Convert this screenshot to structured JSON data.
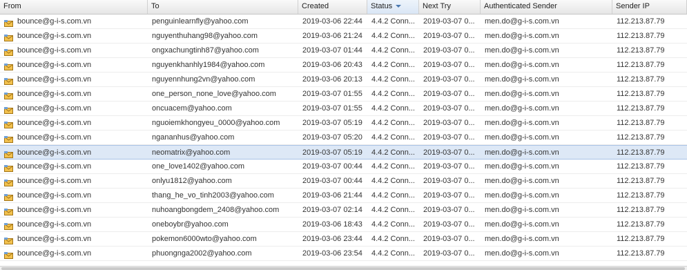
{
  "columns": [
    "From",
    "To",
    "Created",
    "Status",
    "Next Try",
    "Authenticated Sender",
    "Sender IP"
  ],
  "sorted_column": "Status",
  "row_icon": "mail-queue-icon",
  "selected_index": 9,
  "rows": [
    [
      "bounce@g-i-s.com.vn",
      "penguinlearnfly@yahoo.com",
      "2019-03-06 22:44",
      "4.4.2 Conn...",
      "2019-03-07 0...",
      "men.do@g-i-s.com.vn",
      "112.213.87.79"
    ],
    [
      "bounce@g-i-s.com.vn",
      "nguyenthuhang98@yahoo.com",
      "2019-03-06 21:24",
      "4.4.2 Conn...",
      "2019-03-07 0...",
      "men.do@g-i-s.com.vn",
      "112.213.87.79"
    ],
    [
      "bounce@g-i-s.com.vn",
      "ongxachungtinh87@yahoo.com",
      "2019-03-07 01:44",
      "4.4.2 Conn...",
      "2019-03-07 0...",
      "men.do@g-i-s.com.vn",
      "112.213.87.79"
    ],
    [
      "bounce@g-i-s.com.vn",
      "nguyenkhanhly1984@yahoo.com",
      "2019-03-06 20:43",
      "4.4.2 Conn...",
      "2019-03-07 0...",
      "men.do@g-i-s.com.vn",
      "112.213.87.79"
    ],
    [
      "bounce@g-i-s.com.vn",
      "nguyennhung2vn@yahoo.com",
      "2019-03-06 20:13",
      "4.4.2 Conn...",
      "2019-03-07 0...",
      "men.do@g-i-s.com.vn",
      "112.213.87.79"
    ],
    [
      "bounce@g-i-s.com.vn",
      "one_person_none_love@yahoo.com",
      "2019-03-07 01:55",
      "4.4.2 Conn...",
      "2019-03-07 0...",
      "men.do@g-i-s.com.vn",
      "112.213.87.79"
    ],
    [
      "bounce@g-i-s.com.vn",
      "oncuacem@yahoo.com",
      "2019-03-07 01:55",
      "4.4.2 Conn...",
      "2019-03-07 0...",
      "men.do@g-i-s.com.vn",
      "112.213.87.79"
    ],
    [
      "bounce@g-i-s.com.vn",
      "nguoiemkhongyeu_0000@yahoo.com",
      "2019-03-07 05:19",
      "4.4.2 Conn...",
      "2019-03-07 0...",
      "men.do@g-i-s.com.vn",
      "112.213.87.79"
    ],
    [
      "bounce@g-i-s.com.vn",
      "ngananhus@yahoo.com",
      "2019-03-07 05:20",
      "4.4.2 Conn...",
      "2019-03-07 0...",
      "men.do@g-i-s.com.vn",
      "112.213.87.79"
    ],
    [
      "bounce@g-i-s.com.vn",
      "neomatrix@yahoo.com",
      "2019-03-07 05:19",
      "4.4.2 Conn...",
      "2019-03-07 0...",
      "men.do@g-i-s.com.vn",
      "112.213.87.79"
    ],
    [
      "bounce@g-i-s.com.vn",
      "one_love1402@yahoo.com",
      "2019-03-07 00:44",
      "4.4.2 Conn...",
      "2019-03-07 0...",
      "men.do@g-i-s.com.vn",
      "112.213.87.79"
    ],
    [
      "bounce@g-i-s.com.vn",
      "onlyu1812@yahoo.com",
      "2019-03-07 00:44",
      "4.4.2 Conn...",
      "2019-03-07 0...",
      "men.do@g-i-s.com.vn",
      "112.213.87.79"
    ],
    [
      "bounce@g-i-s.com.vn",
      "thang_he_vo_tinh2003@yahoo.com",
      "2019-03-06 21:44",
      "4.4.2 Conn...",
      "2019-03-07 0...",
      "men.do@g-i-s.com.vn",
      "112.213.87.79"
    ],
    [
      "bounce@g-i-s.com.vn",
      "nuhoangbongdem_2408@yahoo.com",
      "2019-03-07 02:14",
      "4.4.2 Conn...",
      "2019-03-07 0...",
      "men.do@g-i-s.com.vn",
      "112.213.87.79"
    ],
    [
      "bounce@g-i-s.com.vn",
      "oneboybr@yahoo.com",
      "2019-03-06 18:43",
      "4.4.2 Conn...",
      "2019-03-07 0...",
      "men.do@g-i-s.com.vn",
      "112.213.87.79"
    ],
    [
      "bounce@g-i-s.com.vn",
      "pokemon6000wto@yahoo.com",
      "2019-03-06 23:44",
      "4.4.2 Conn...",
      "2019-03-07 0...",
      "men.do@g-i-s.com.vn",
      "112.213.87.79"
    ],
    [
      "bounce@g-i-s.com.vn",
      "phuongnga2002@yahoo.com",
      "2019-03-06 23:54",
      "4.4.2 Conn...",
      "2019-03-07 0...",
      "men.do@g-i-s.com.vn",
      "112.213.87.79"
    ]
  ]
}
